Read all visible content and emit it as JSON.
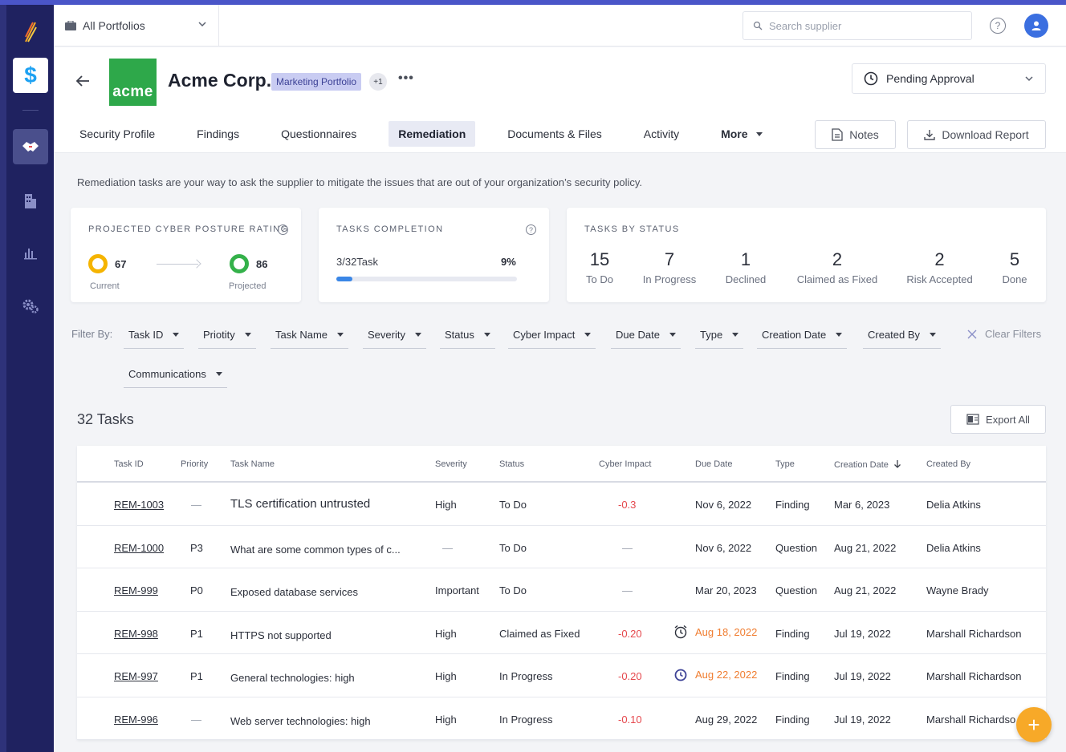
{
  "topbar": {
    "portfolio_label": "All Portfolios",
    "search_placeholder": "Search supplier",
    "help": "?"
  },
  "header": {
    "logo_text": "acme",
    "company": "Acme Corp.",
    "tag": "Marketing Portfolio",
    "more_tags": "+1",
    "status": "Pending Approval"
  },
  "tabs": [
    "Security Profile",
    "Findings",
    "Questionnaires",
    "Remediation",
    "Documents & Files",
    "Activity",
    "More"
  ],
  "actions": {
    "notes": "Notes",
    "download": "Download Report"
  },
  "intro": "Remediation tasks are your way to ask the supplier to mitigate the issues that are out of your organization’s security policy.",
  "rating_card": {
    "title": "PROJECTED CYBER POSTURE RATING",
    "current_value": "67",
    "current_label": "Current",
    "projected_value": "86",
    "projected_label": "Projected"
  },
  "completion_card": {
    "title": "TASKS COMPLETION",
    "count": "3/32Task",
    "percent": "9%",
    "progress": 0.09
  },
  "status_card": {
    "title": "TASKS BY STATUS",
    "stats": [
      {
        "n": "15",
        "label": "To Do"
      },
      {
        "n": "7",
        "label": "In Progress"
      },
      {
        "n": "1",
        "label": "Declined"
      },
      {
        "n": "2",
        "label": "Claimed as Fixed"
      },
      {
        "n": "2",
        "label": "Risk Accepted"
      },
      {
        "n": "5",
        "label": "Done"
      }
    ]
  },
  "filters": {
    "label": "Filter By:",
    "items": [
      "Task ID",
      "Priotity",
      "Task Name",
      "Severity",
      "Status",
      "Cyber Impact",
      "Due Date",
      "Type",
      "Creation Date",
      "Created By",
      "Communications"
    ],
    "clear": "Clear Filters"
  },
  "tasks_count": "32 Tasks",
  "export": "Export All",
  "table": {
    "columns": [
      "Task ID",
      "Priority",
      "Task Name",
      "Severity",
      "Status",
      "Cyber Impact",
      "Due Date",
      "Type",
      "Creation Date",
      "Created By"
    ],
    "rows": [
      {
        "id": "REM-1003",
        "priority": "—",
        "name": "TLS certification untrusted",
        "severity": "High",
        "status": "To Do",
        "impact": "-0.3",
        "due": "Nov 6, 2022",
        "type": "Finding",
        "created": "Mar 6, 2023",
        "by": "Delia Atkins"
      },
      {
        "id": "REM-1000",
        "priority": "P3",
        "name": "What are some common types of c...",
        "severity": "—",
        "status": "To Do",
        "impact": "—",
        "due": "Nov 6, 2022",
        "type": "Question",
        "created": "Aug 21, 2022",
        "by": "Delia Atkins"
      },
      {
        "id": "REM-999",
        "priority": "P0",
        "name": "Exposed database services",
        "severity": "Important",
        "status": "To Do",
        "impact": "—",
        "due": "Mar 20, 2023",
        "type": "Question",
        "created": "Aug 21, 2022",
        "by": "Wayne Brady"
      },
      {
        "id": "REM-998",
        "priority": "P1",
        "name": "HTTPS not supported",
        "severity": "High",
        "status": "Claimed as Fixed",
        "impact": "-0.20",
        "due": "Aug 18, 2022",
        "type": "Finding",
        "created": "Jul 19, 2022",
        "by": "Marshall Richardson"
      },
      {
        "id": "REM-997",
        "priority": "P1",
        "name": "General technologies: high",
        "severity": "High",
        "status": "In Progress",
        "impact": "-0.20",
        "due": "Aug 22, 2022",
        "type": "Finding",
        "created": "Jul 19, 2022",
        "by": "Marshall Richardson"
      },
      {
        "id": "REM-996",
        "priority": "—",
        "name": "Web server technologies: high",
        "severity": "High",
        "status": "In Progress",
        "impact": "-0.10",
        "due": "Aug 29, 2022",
        "type": "Finding",
        "created": "Jul 19, 2022",
        "by": "Marshall Richardso"
      }
    ]
  },
  "fab": "+",
  "colors": {
    "accent": "#3a86e6",
    "negative": "#e5484d",
    "overdue": "#f07d30",
    "current_rating": "#f5b400",
    "projected_rating": "#34b14a"
  }
}
